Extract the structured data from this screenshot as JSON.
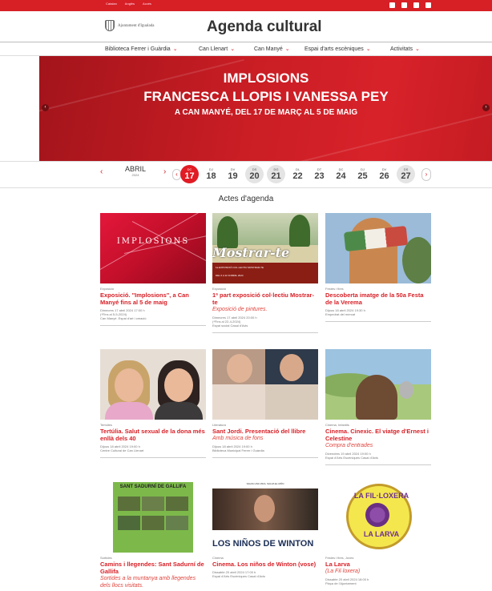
{
  "topbar": {
    "links": [
      "Catalan",
      "Anglès",
      "Accés"
    ]
  },
  "header": {
    "logo_text": "Ajuntament d'Igualada",
    "title": "Agenda cultural"
  },
  "nav": [
    {
      "label": "Biblioteca Ferrer i Guàrdia"
    },
    {
      "label": "Can Llenart"
    },
    {
      "label": "Can Manyé"
    },
    {
      "label": "Espai d'arts escèniques"
    },
    {
      "label": "Activitats"
    }
  ],
  "hero": {
    "line1": "IMPLOSIONS",
    "line2": "FRANCESCA LLOPIS I VANESSA PEY",
    "line3": "A CAN MANYÉ, DEL 17 DE MARÇ AL 5 DE MAIG"
  },
  "calendar": {
    "month": "ABRIL",
    "year": "2024",
    "days": [
      {
        "name": "DC",
        "num": "17",
        "state": "selected"
      },
      {
        "name": "DJ",
        "num": "18",
        "state": ""
      },
      {
        "name": "DV",
        "num": "19",
        "state": ""
      },
      {
        "name": "DS",
        "num": "20",
        "state": "weekend"
      },
      {
        "name": "DG",
        "num": "21",
        "state": "weekend"
      },
      {
        "name": "DL",
        "num": "22",
        "state": ""
      },
      {
        "name": "DT",
        "num": "23",
        "state": ""
      },
      {
        "name": "DC",
        "num": "24",
        "state": ""
      },
      {
        "name": "DJ",
        "num": "25",
        "state": ""
      },
      {
        "name": "DV",
        "num": "26",
        "state": ""
      },
      {
        "name": "DS",
        "num": "27",
        "state": "weekend"
      }
    ]
  },
  "section_title": "Actes d'agenda",
  "image_text": {
    "implosions": "IMPLOSIONS",
    "mostrar": "Mostrar-te",
    "mostrar_band": "1a EXPOSICIÓ COL·LECTIU MOSTRAR-TE",
    "mostrar_dates": "DEL 6 A 22 D'ABRIL 2024",
    "camins": "SANT SADURNÍ DE GALLIFA",
    "winton_top": "SALVA UNA VIDA, SALVA EL MÓN",
    "winton_logo": "LOS NIÑOS DE WINTON",
    "larva_top": "LA FIL·LOXERA",
    "larva_bottom": "LA LARVA"
  },
  "events": [
    {
      "category": "Exposició",
      "title": "Exposició. \"Implosions\", a Can Manyé fins al 5 de maig",
      "subtitle": "",
      "meta": [
        "Dimecres 17 abril 2024 17:00 h",
        "(*Fins al 5-5-2024)",
        "Can Manyé. Espai d'art i creació"
      ]
    },
    {
      "category": "Exposició",
      "title": "1ª part exposició col·lectiu Mostrar-te",
      "subtitle": "Exposició de pintures.",
      "meta": [
        "Dimecres 17 abril 2024 20:00 h",
        "(*Fins al 22-4-2024)",
        "Espai social Casal d'Avis"
      ]
    },
    {
      "category": "Festes i fires",
      "title": "Descoberta imatge de la 50a Festa de la Verema",
      "subtitle": "",
      "meta": [
        "Dijous 18 abril 2024 19:30 h",
        "Empedrat del mercat"
      ]
    },
    {
      "category": "Tertúlies",
      "title": "Tertúlia. Salut sexual de la dona més enllà dels 40",
      "subtitle": "",
      "meta": [
        "Dijous 18 abril 2024 19:00 h",
        "Centre Cultural de Can Llenart"
      ]
    },
    {
      "category": "Literatura",
      "title": "Sant Jordi. Presentació del llibre",
      "subtitle": "Amb música de fons",
      "meta": [
        "Dijous 18 abril 2024 19:00 h",
        "Biblioteca Municipal Ferrer i Guàrdia"
      ]
    },
    {
      "category": "Cinema, Infantils",
      "title": "Cinema. Cinexic. El viatge d'Ernest i Celestine",
      "subtitle": "Compra d'entrades",
      "meta": [
        "Divendres 19 abril 2024 19:00 h",
        "Espai d'Arts Escèniques Casal d'Avis"
      ]
    },
    {
      "category": "Sortides",
      "title": "Camins i llegendes: Sant Sadurní de Gallifa",
      "subtitle": "Sortides a la muntanya amb llegendes dels llocs visitats.",
      "meta": []
    },
    {
      "category": "Cinema",
      "title": "Cinema. Los niños de Winton (vose)",
      "subtitle": "",
      "meta": [
        "Dissabte 20 abril 2024 17:00 h",
        "Espai d'Arts Escèniques Casal d'Avis"
      ]
    },
    {
      "category": "Festes i fires, Joves",
      "title": "La Larva",
      "subtitle": "(La Fil·loxera)",
      "meta": [
        "Dissabte 20 abril 2024 18:00 h",
        "Plaça de l'Ajuntament"
      ]
    }
  ]
}
